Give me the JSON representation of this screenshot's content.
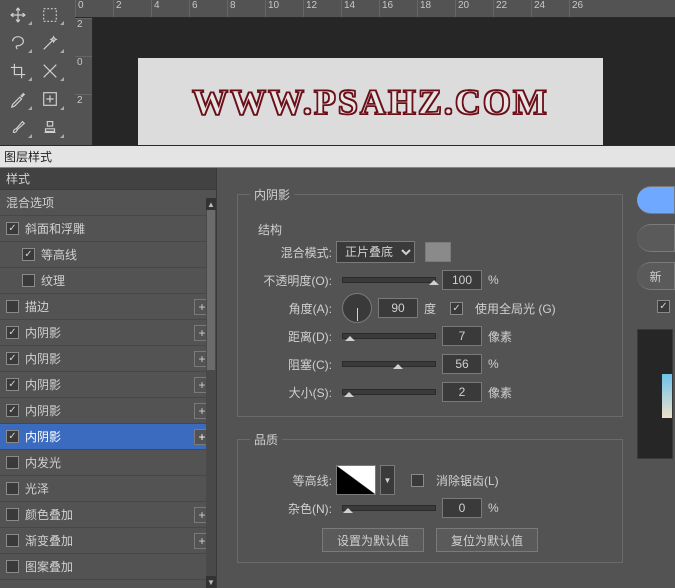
{
  "ruler_h": [
    "0",
    "2",
    "4",
    "6",
    "8",
    "10",
    "12",
    "14",
    "16",
    "18",
    "20",
    "22",
    "24",
    "26"
  ],
  "ruler_v": [
    "2",
    "0",
    "2"
  ],
  "canvas_text": "WWW.PSAHZ.COM",
  "dialog": {
    "title": "图层样式",
    "styles_header": "样式",
    "blend_options": "混合选项",
    "items": {
      "bevel": "斜面和浮雕",
      "contour_sub": "等高线",
      "texture_sub": "纹理",
      "stroke": "描边",
      "inner_shadow1": "内阴影",
      "inner_shadow2": "内阴影",
      "inner_shadow3": "内阴影",
      "inner_shadow4": "内阴影",
      "inner_shadow5": "内阴影",
      "inner_glow": "内发光",
      "satin": "光泽",
      "color_overlay": "颜色叠加",
      "gradient_overlay": "渐变叠加",
      "pattern_overlay": "图案叠加"
    }
  },
  "panel": {
    "legend": "内阴影",
    "structure": "结构",
    "blend_mode_lbl": "混合模式:",
    "blend_mode_val": "正片叠底",
    "opacity_lbl": "不透明度(O):",
    "opacity_val": "100",
    "percent": "%",
    "angle_lbl": "角度(A):",
    "angle_val": "90",
    "degree": "度",
    "global_light": "使用全局光 (G)",
    "distance_lbl": "距离(D):",
    "distance_val": "7",
    "pixels": "像素",
    "choke_lbl": "阻塞(C):",
    "choke_val": "56",
    "size_lbl": "大小(S):",
    "size_val": "2",
    "quality": "品质",
    "contour_lbl": "等高线:",
    "antialias": "消除锯齿(L)",
    "noise_lbl": "杂色(N):",
    "noise_val": "0",
    "set_default": "设置为默认值",
    "reset_default": "复位为默认值"
  },
  "right": {
    "new": "新"
  }
}
